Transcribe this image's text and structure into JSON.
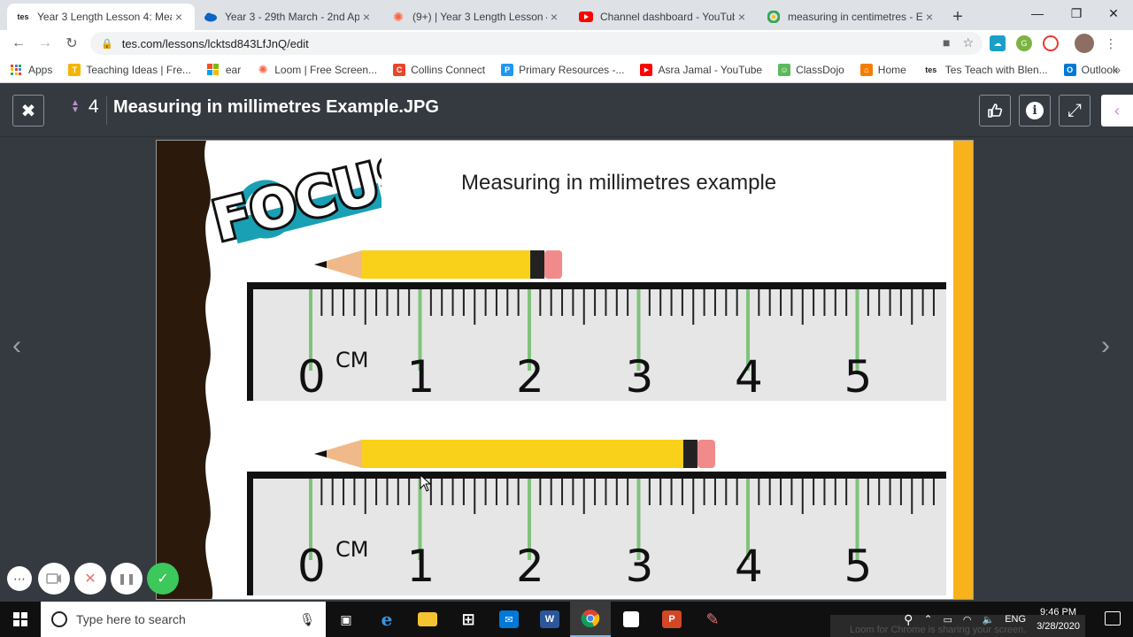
{
  "browser": {
    "tabs": [
      {
        "favicon": "tes-icon",
        "fav_text": "tes",
        "title": "Year 3 Length Lesson 4: Measu",
        "active": true
      },
      {
        "favicon": "onedrive-icon",
        "fav_text": "",
        "title": "Year 3 - 29th March - 2nd April",
        "active": false
      },
      {
        "favicon": "loom-icon",
        "fav_text": "",
        "title": "(9+) | Year 3 Length Lesson 4: M",
        "active": false
      },
      {
        "favicon": "youtube-icon",
        "fav_text": "",
        "title": "Channel dashboard - YouTube",
        "active": false
      },
      {
        "favicon": "google-icon",
        "fav_text": "",
        "title": "measuring in centimetres - Eco",
        "active": false
      }
    ],
    "new_tab": "+",
    "window_controls": {
      "minimize": "—",
      "restore": "❐",
      "close": "✕"
    },
    "url": "tes.com/lessons/lcktsd843LfJnQ/edit",
    "bookmarks": [
      {
        "icon": "apps-grid-icon",
        "label": "Apps",
        "color": "#4285f4",
        "glyph": "⋮"
      },
      {
        "icon": "teaching-ideas-icon",
        "label": "Teaching Ideas | Fre...",
        "color": "#f4b400",
        "glyph": "T"
      },
      {
        "icon": "microsoft-icon",
        "label": "ear",
        "color": "#f25022",
        "glyph": ""
      },
      {
        "icon": "loom-icon",
        "label": "Loom | Free Screen...",
        "color": "#ff623e",
        "glyph": "✺"
      },
      {
        "icon": "collins-icon",
        "label": "Collins Connect",
        "color": "#e8452c",
        "glyph": "C"
      },
      {
        "icon": "primary-resources-icon",
        "label": "Primary Resources -...",
        "color": "#2196f3",
        "glyph": "P"
      },
      {
        "icon": "youtube-icon",
        "label": "Asra Jamal - YouTube",
        "color": "#ff0000",
        "glyph": "▶"
      },
      {
        "icon": "classdojo-icon",
        "label": "ClassDojo",
        "color": "#5cb85c",
        "glyph": "☺"
      },
      {
        "icon": "home-icon",
        "label": "Home",
        "color": "#f57c00",
        "glyph": "⌂"
      },
      {
        "icon": "tes-icon",
        "label": "Tes Teach with Blen...",
        "color": "#222222",
        "glyph": "tes"
      },
      {
        "icon": "outlook-icon",
        "label": "Outlook",
        "color": "#0078d4",
        "glyph": "O"
      }
    ],
    "bookmarks_more": "»"
  },
  "viewer": {
    "close_glyph": "✖",
    "slide_number": "4",
    "title": "Measuring in millimetres Example.JPG",
    "buttons": {
      "like": "👍",
      "info": "i",
      "expand": "⤢",
      "collapse": "‹"
    },
    "prev": "‹",
    "next": "›"
  },
  "slide": {
    "heading": "Measuring in millimetres example",
    "logo_text": "FOCUS",
    "ruler_unit": "CM",
    "ruler_numbers": [
      "0",
      "1",
      "2",
      "3",
      "4",
      "5"
    ],
    "pencil_lengths_mm": [
      23,
      37
    ],
    "colors": {
      "pencil": "#f9d11a",
      "ruler": "#e6e6e6",
      "cm_tick": "#7fc37a",
      "edge": "#f8b21b",
      "logo": "#1aa0b4"
    }
  },
  "recorder": {
    "more": "⋯",
    "camera": "▭",
    "cancel": "✕",
    "pause": "❚❚",
    "done": "✓"
  },
  "taskbar": {
    "search_placeholder": "Type here to search",
    "apps": [
      {
        "icon": "task-view-icon",
        "glyph": "▣",
        "color": "#101010"
      },
      {
        "icon": "edge-icon",
        "glyph": "e",
        "color": "#0078d7"
      },
      {
        "icon": "file-explorer-icon",
        "glyph": "▬",
        "color": "#f4c430"
      },
      {
        "icon": "store-icon",
        "glyph": "⊞",
        "color": "#0078d7"
      },
      {
        "icon": "mail-icon",
        "glyph": "✉",
        "color": "#0078d7"
      },
      {
        "icon": "word-icon",
        "glyph": "W",
        "color": "#2b579a"
      },
      {
        "icon": "chrome-icon",
        "glyph": "◉",
        "color": "#db4437"
      },
      {
        "icon": "sticky-notes-icon",
        "glyph": "◢",
        "color": "#333333"
      },
      {
        "icon": "powerpoint-icon",
        "glyph": "P",
        "color": "#d24726"
      },
      {
        "icon": "paint-icon",
        "glyph": "✎",
        "color": "#555555"
      }
    ],
    "language": "ENG",
    "time": "9:46 PM",
    "date": "3/28/2020",
    "loom_banner": "Loom for Chrome is sharing your screen."
  }
}
